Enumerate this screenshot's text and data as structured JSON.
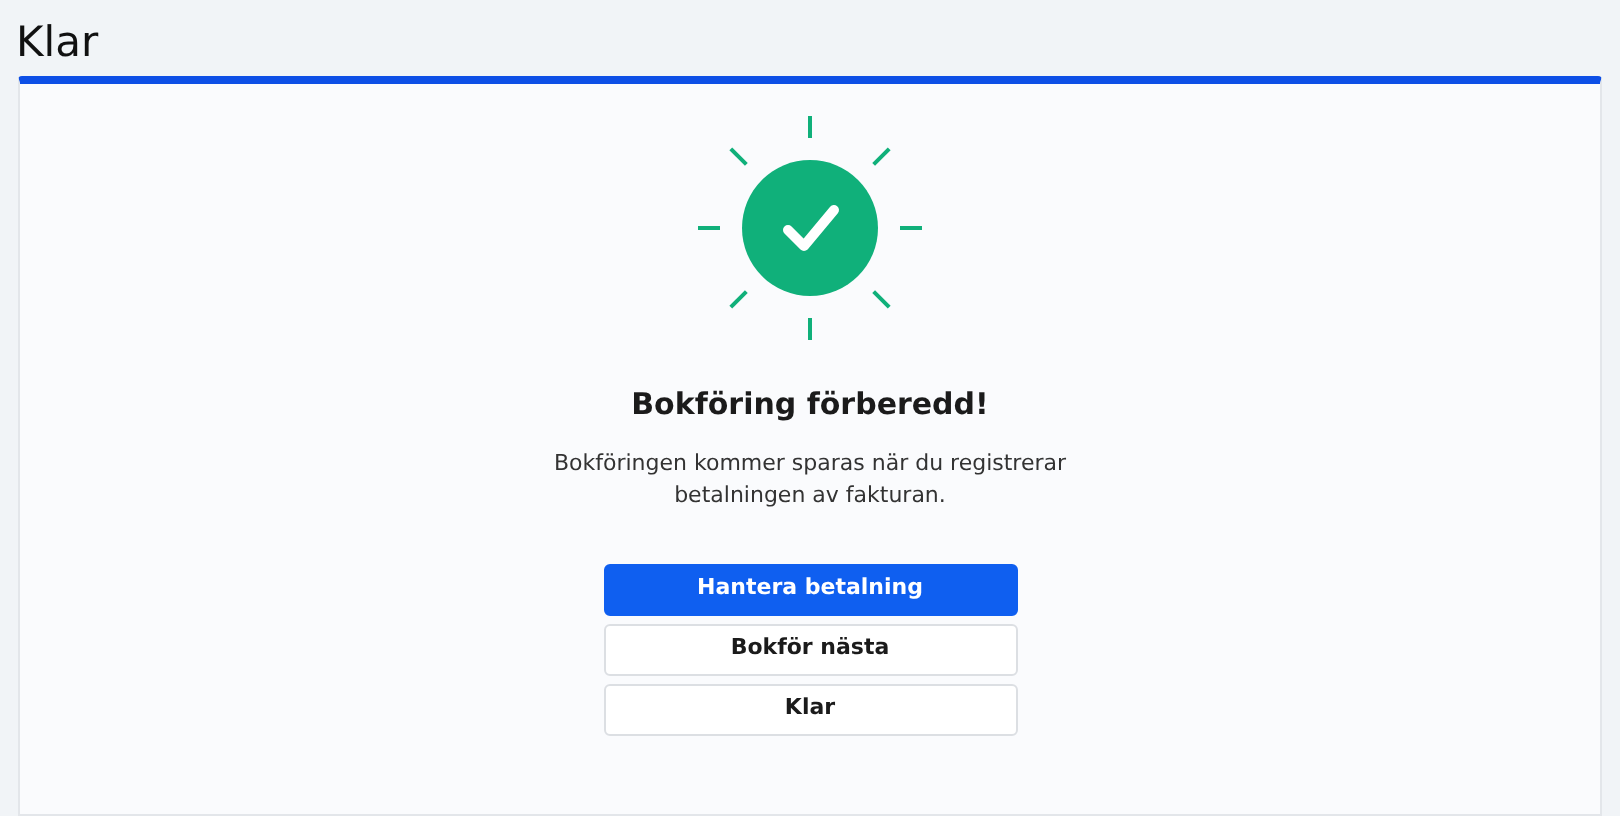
{
  "page": {
    "title": "Klar"
  },
  "panel": {
    "heading": "Bokföring förberedd!",
    "message": "Bokföringen kommer sparas när du registrerar betalningen av fakturan."
  },
  "buttons": [
    {
      "label": "Hantera betalning",
      "kind": "primary"
    },
    {
      "label": "Bokför nästa",
      "kind": "secondary"
    },
    {
      "label": "Klar",
      "kind": "secondary"
    }
  ]
}
